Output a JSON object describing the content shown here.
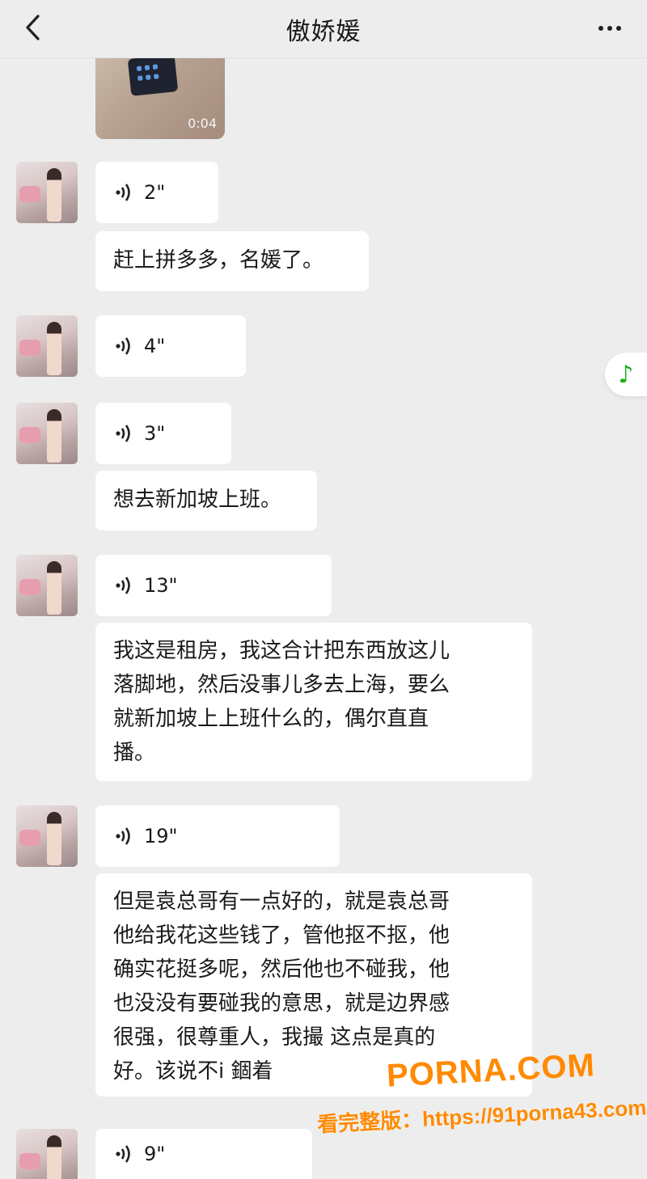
{
  "header": {
    "title": "傲娇媛"
  },
  "video": {
    "duration": "0:04"
  },
  "messages": [
    {
      "type": "voice",
      "duration": "2\""
    },
    {
      "type": "text",
      "content": "赶上拼多多，名媛了。"
    },
    {
      "type": "voice",
      "duration": "4\""
    },
    {
      "type": "voice",
      "duration": "3\""
    },
    {
      "type": "text",
      "content": "想去新加坡上班。"
    },
    {
      "type": "voice",
      "duration": "13\""
    },
    {
      "type": "text",
      "lines": [
        "我这是租房，我这合计把东西放这儿",
        "落脚地，然后没事儿多去上海，要么",
        "就新加坡上上班什么的，偶尔直直",
        "播。"
      ]
    },
    {
      "type": "voice",
      "duration": "19\""
    },
    {
      "type": "text",
      "lines": [
        "但是袁总哥有一点好的，就是袁总哥",
        "他给我花这些钱了，管他抠不抠，他",
        "确实花挺多呢，然后他也不碰我，他",
        "也没没有要碰我的意思，就是边界感",
        "很强，很尊重人，我撮  这点是真的",
        "好。该说不i           錮着"
      ]
    },
    {
      "type": "voice",
      "duration": "9\""
    }
  ],
  "watermark": {
    "brand": "PORNA.COM",
    "line2": "看完整版：https://91porna43.com"
  },
  "icons": {
    "back": "chevron-left-icon",
    "more": "more-dots-icon",
    "voice": "voice-wave-icon",
    "music": "music-note-icon"
  }
}
